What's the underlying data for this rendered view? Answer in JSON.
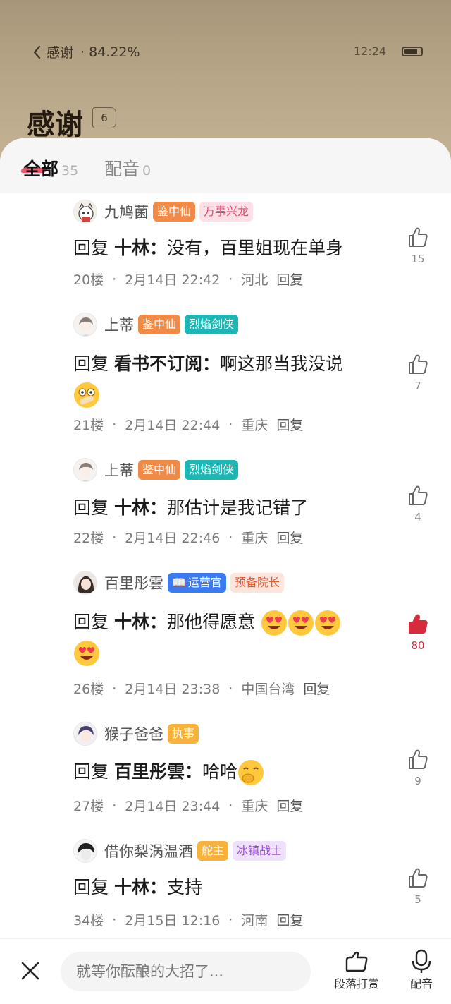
{
  "status": {
    "back_title": "感谢",
    "progress": "· 84.22%",
    "time": "12:24"
  },
  "header": {
    "title": "感谢",
    "count": "6"
  },
  "tabs": [
    {
      "label": "全部",
      "count": "35"
    },
    {
      "label": "配音",
      "count": "0"
    }
  ],
  "comments": [
    {
      "user": "九鸠菌",
      "badges": [
        "鉴中仙",
        "万事兴龙"
      ],
      "reply_prefix": "回复",
      "reply_to": "十林：",
      "text": "没有，百里姐现在单身",
      "floor": "20楼",
      "time": "2月14日 22:42",
      "location": "河北",
      "reply_label": "回复",
      "likes": "15",
      "liked": false
    },
    {
      "user": "上蒂",
      "badges": [
        "鉴中仙",
        "烈焰剑侠"
      ],
      "reply_prefix": "回复",
      "reply_to": "看书不订阅：",
      "text": "啊这那当我没说",
      "emoji": "shocked-emoji",
      "floor": "21楼",
      "time": "2月14日 22:44",
      "location": "重庆",
      "reply_label": "回复",
      "likes": "7",
      "liked": false
    },
    {
      "user": "上蒂",
      "badges": [
        "鉴中仙",
        "烈焰剑侠"
      ],
      "reply_prefix": "回复",
      "reply_to": "十林：",
      "text": "那估计是我记错了",
      "floor": "22楼",
      "time": "2月14日 22:46",
      "location": "重庆",
      "reply_label": "回复",
      "likes": "4",
      "liked": false
    },
    {
      "user": "百里彤雲",
      "badges": [
        "运营官",
        "预备院长"
      ],
      "reply_prefix": "回复",
      "reply_to": "十林：",
      "text": "那他得愿意",
      "emoji": "heart-eyes-emoji x4",
      "floor": "26楼",
      "time": "2月14日 23:38",
      "location": "中国台湾",
      "reply_label": "回复",
      "likes": "80",
      "liked": true
    },
    {
      "user": "猴子爸爸",
      "badges": [
        "执事"
      ],
      "reply_prefix": "回复",
      "reply_to": "百里彤雲：",
      "text": "哈哈",
      "emoji": "giggle-emoji",
      "floor": "27楼",
      "time": "2月14日 23:44",
      "location": "重庆",
      "reply_label": "回复",
      "likes": "9",
      "liked": false
    },
    {
      "user": "借你梨涡温酒",
      "badges": [
        "舵主",
        "冰镇战士"
      ],
      "reply_prefix": "回复",
      "reply_to": "十林：",
      "text": "支持",
      "floor": "34楼",
      "time": "2月15日 12:16",
      "location": "河南",
      "reply_label": "回复",
      "likes": "5",
      "liked": false
    }
  ],
  "bottom_bar": {
    "placeholder": "就等你酝酿的大招了...",
    "reward_label": "段落打赏",
    "dub_label": "配音"
  },
  "colors": {
    "accent_red": "#d62b3d",
    "tab_indicator": "#e84a5f"
  }
}
